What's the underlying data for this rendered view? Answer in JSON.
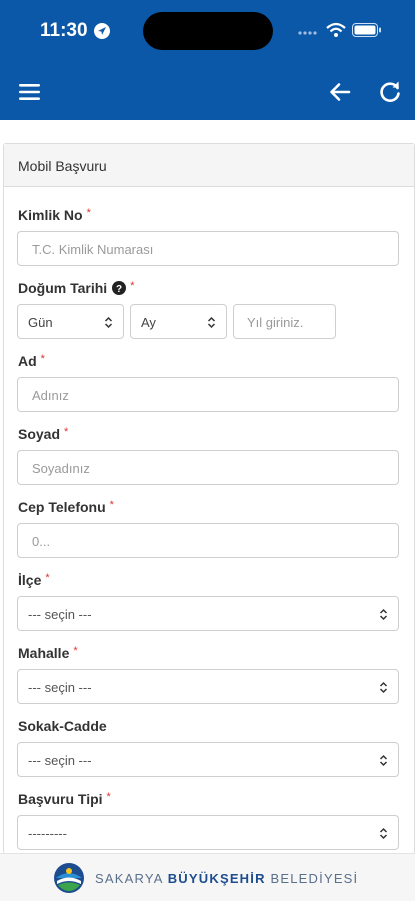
{
  "status_bar": {
    "time": "11:30"
  },
  "app_bar": {
    "menu_icon": "hamburger-icon",
    "back_icon": "arrow-left-icon",
    "refresh_icon": "refresh-icon"
  },
  "form": {
    "title": "Mobil Başvuru",
    "required_mark": "*",
    "fields": {
      "kimlik": {
        "label": "Kimlik No",
        "placeholder": "T.C. Kimlik Numarası"
      },
      "dogum": {
        "label": "Doğum Tarihi",
        "day_value": "Gün",
        "month_value": "Ay",
        "year_placeholder": "Yıl giriniz."
      },
      "ad": {
        "label": "Ad",
        "placeholder": "Adınız"
      },
      "soyad": {
        "label": "Soyad",
        "placeholder": "Soyadınız"
      },
      "telefon": {
        "label": "Cep Telefonu",
        "placeholder": "0..."
      },
      "ilce": {
        "label": "İlçe",
        "value": "--- seçin ---"
      },
      "mahalle": {
        "label": "Mahalle",
        "value": "--- seçin ---"
      },
      "sokak": {
        "label": "Sokak-Cadde",
        "value": "--- seçin ---"
      },
      "basvuru_tipi": {
        "label": "Başvuru Tipi",
        "value": "---------"
      }
    }
  },
  "footer": {
    "brand_left": "SAKARYA",
    "brand_bold": "BÜYÜKŞEHİR",
    "brand_right": "BELEDİYESİ"
  },
  "colors": {
    "header_bg": "#0b58a9",
    "required": "#e0322f",
    "brand_blue": "#1d4d8f"
  }
}
